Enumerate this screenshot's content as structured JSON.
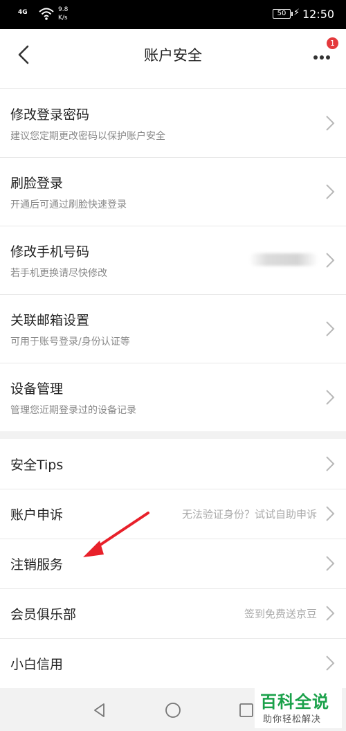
{
  "status_bar": {
    "signal": "4G",
    "net_speed_value": "9.8",
    "net_speed_unit": "K/s",
    "battery": "50",
    "time": "12:50"
  },
  "header": {
    "title": "账户安全",
    "back_icon": "chevron-left-icon",
    "more_icon": "more-dots-icon",
    "badge_count": "1"
  },
  "section1": [
    {
      "title": "修改登录密码",
      "subtitle": "建议您定期更改密码以保护账户安全"
    },
    {
      "title": "刷脸登录",
      "subtitle": "开通后可通过刷脸快速登录"
    },
    {
      "title": "修改手机号码",
      "subtitle": "若手机更换请尽快修改"
    },
    {
      "title": "关联邮箱设置",
      "subtitle": "可用于账号登录/身份认证等"
    },
    {
      "title": "设备管理",
      "subtitle": "管理您近期登录过的设备记录"
    }
  ],
  "section2": [
    {
      "title": "安全Tips",
      "hint": ""
    },
    {
      "title": "账户申诉",
      "hint": "无法验证身份？试试自助申诉"
    },
    {
      "title": "注销服务",
      "hint": ""
    },
    {
      "title": "会员俱乐部",
      "hint": "签到免费送京豆"
    },
    {
      "title": "小白信用",
      "hint": ""
    }
  ],
  "watermark": {
    "main": "百科全说",
    "sub": "助你轻松解决"
  },
  "colors": {
    "badge": "#e4393c",
    "annotation_arrow": "#e8202a",
    "watermark_green": "#1aa14a"
  }
}
